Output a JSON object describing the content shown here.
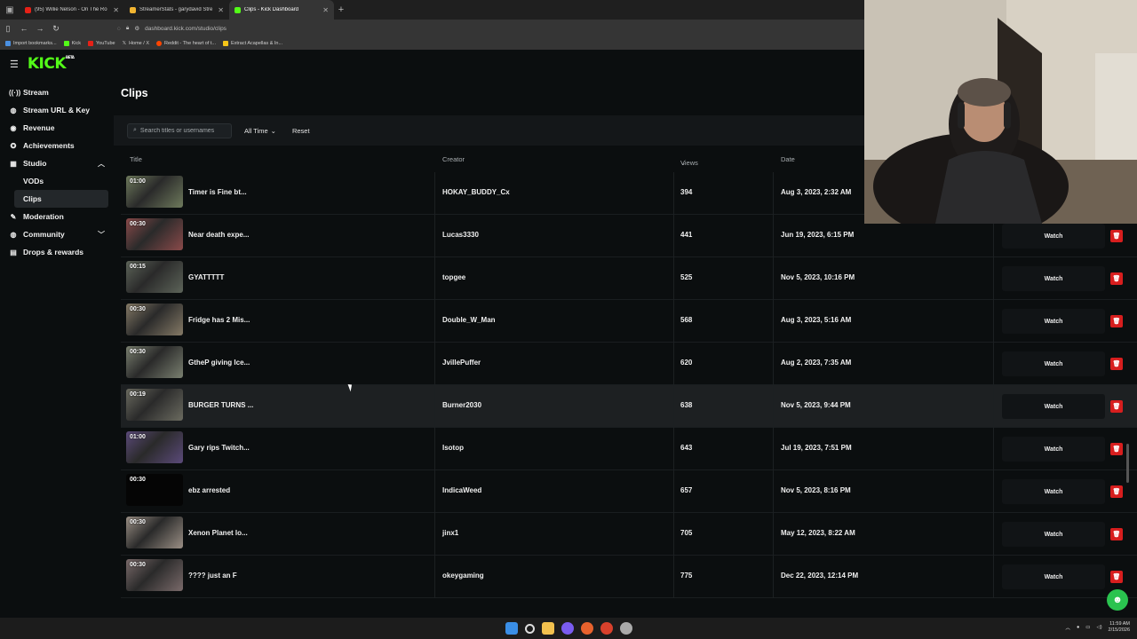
{
  "browser": {
    "tabs": [
      {
        "label": "(95) Willie Nelson - On The Ro",
        "color": "#e62117"
      },
      {
        "label": "StreamerStats - garydavid Stre",
        "color": "#f2b531"
      },
      {
        "label": "Clips - Kick Dashboard",
        "color": "#53fc18",
        "active": true
      }
    ],
    "url": "dashboard.kick.com/studio/clips",
    "bookmarks": [
      {
        "label": "Import bookmarks...",
        "color": "#4a90e2"
      },
      {
        "label": "Kick",
        "color": "#53fc18"
      },
      {
        "label": "YouTube",
        "color": "#e62117"
      },
      {
        "label": "Home / X",
        "color": "#ffffff"
      },
      {
        "label": "Reddit - The heart of t...",
        "color": "#ff4500"
      },
      {
        "label": "Extract Acapellas & In...",
        "color": "#f5c518"
      }
    ]
  },
  "sidebar": {
    "logo": "KICK",
    "logo_sup": "BETA",
    "items": [
      {
        "label": "Stream",
        "icon": "broadcast-icon"
      },
      {
        "label": "Stream URL & Key",
        "icon": "globe-icon"
      },
      {
        "label": "Revenue",
        "icon": "dollar-icon"
      },
      {
        "label": "Achievements",
        "icon": "trophy-icon"
      },
      {
        "label": "Studio",
        "icon": "grid-icon"
      },
      {
        "label": "VODs"
      },
      {
        "label": "Clips"
      },
      {
        "label": "Moderation",
        "icon": "wrench-icon"
      },
      {
        "label": "Community",
        "icon": "globe-icon"
      },
      {
        "label": "Drops & rewards",
        "icon": "gift-icon"
      }
    ]
  },
  "page": {
    "title": "Clips",
    "search_placeholder": "Search titles or usernames",
    "filter_label": "All Time",
    "reset_label": "Reset"
  },
  "table": {
    "headers": {
      "title": "Title",
      "creator": "Creator",
      "views": "Views",
      "date": "Date"
    },
    "watch_label": "Watch",
    "rows": [
      {
        "duration": "01:00",
        "title": "Timer is Fine bt...",
        "creator": "HOKAY_BUDDY_Cx",
        "views": "394",
        "date": "Aug 3, 2023, 2:32 AM",
        "thumb": "#6e7a5c"
      },
      {
        "duration": "00:30",
        "title": "Near death expe...",
        "creator": "Lucas3330",
        "views": "441",
        "date": "Jun 19, 2023, 6:15 PM",
        "thumb": "#8a4a4a"
      },
      {
        "duration": "00:15",
        "title": "GYATTTTT",
        "creator": "topgee",
        "views": "525",
        "date": "Nov 5, 2023, 10:16 PM",
        "thumb": "#5d6459"
      },
      {
        "duration": "00:30",
        "title": "Fridge has 2 Mis...",
        "creator": "Double_W_Man",
        "views": "568",
        "date": "Aug 3, 2023, 5:16 AM",
        "thumb": "#857a66"
      },
      {
        "duration": "00:30",
        "title": "GtheP giving Ice...",
        "creator": "JvillePuffer",
        "views": "620",
        "date": "Aug 2, 2023, 7:35 AM",
        "thumb": "#7a8070"
      },
      {
        "duration": "00:19",
        "title": "BURGER TURNS ...",
        "creator": "Burner2030",
        "views": "638",
        "date": "Nov 5, 2023, 9:44 PM",
        "thumb": "#6b6b60"
      },
      {
        "duration": "01:00",
        "title": "Gary rips Twitch...",
        "creator": "Isotop",
        "views": "643",
        "date": "Jul 19, 2023, 7:51 PM",
        "thumb": "#5b4a7a"
      },
      {
        "duration": "00:30",
        "title": "ebz arrested",
        "creator": "IndicaWeed",
        "views": "657",
        "date": "Nov 5, 2023, 8:16 PM",
        "thumb": "#050505"
      },
      {
        "duration": "00:30",
        "title": "Xenon Planet lo...",
        "creator": "jinx1",
        "views": "705",
        "date": "May 12, 2023, 8:22 AM",
        "thumb": "#9a8f85"
      },
      {
        "duration": "00:30",
        "title": "???? just an F",
        "creator": "okeygaming",
        "views": "775",
        "date": "Dec 22, 2023, 12:14 PM",
        "thumb": "#7a6a6a"
      }
    ]
  },
  "taskbar": {
    "time": "11:59 AM",
    "date": "2/15/2026"
  }
}
